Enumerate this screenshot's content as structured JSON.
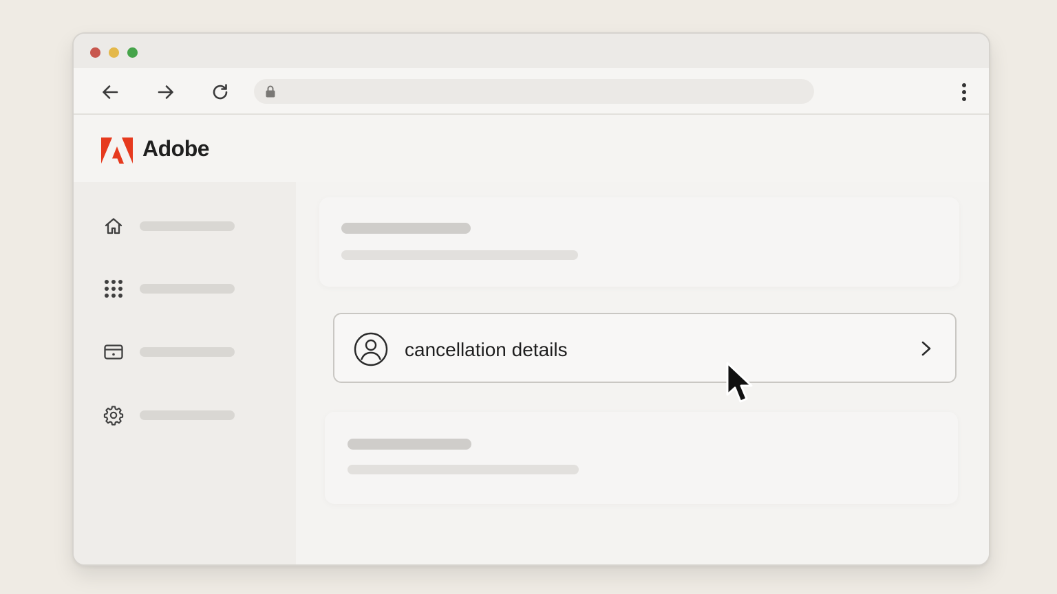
{
  "window": {
    "traffic_lights": [
      {
        "name": "close",
        "color": "#c8574e"
      },
      {
        "name": "minimize",
        "color": "#e4b84a"
      },
      {
        "name": "maximize",
        "color": "#46a44a"
      }
    ]
  },
  "toolbar": {
    "back_icon": "arrow-left-icon",
    "forward_icon": "arrow-right-icon",
    "reload_icon": "reload-icon",
    "address": {
      "icon": "lock-icon",
      "url": ""
    },
    "menu_icon": "more-vertical-icon"
  },
  "header": {
    "brand_name": "Adobe",
    "logo_color": "#e63a1e"
  },
  "sidebar": {
    "items": [
      {
        "icon": "home-icon",
        "label": ""
      },
      {
        "icon": "apps-grid-icon",
        "label": ""
      },
      {
        "icon": "billing-card-icon",
        "label": ""
      },
      {
        "icon": "gear-icon",
        "label": ""
      }
    ]
  },
  "main": {
    "cancellation_row": {
      "icon": "user-circle-icon",
      "label": "cancellation details",
      "chevron_icon": "chevron-right-icon"
    }
  },
  "pointer": {
    "icon": "mouse-pointer-icon"
  }
}
